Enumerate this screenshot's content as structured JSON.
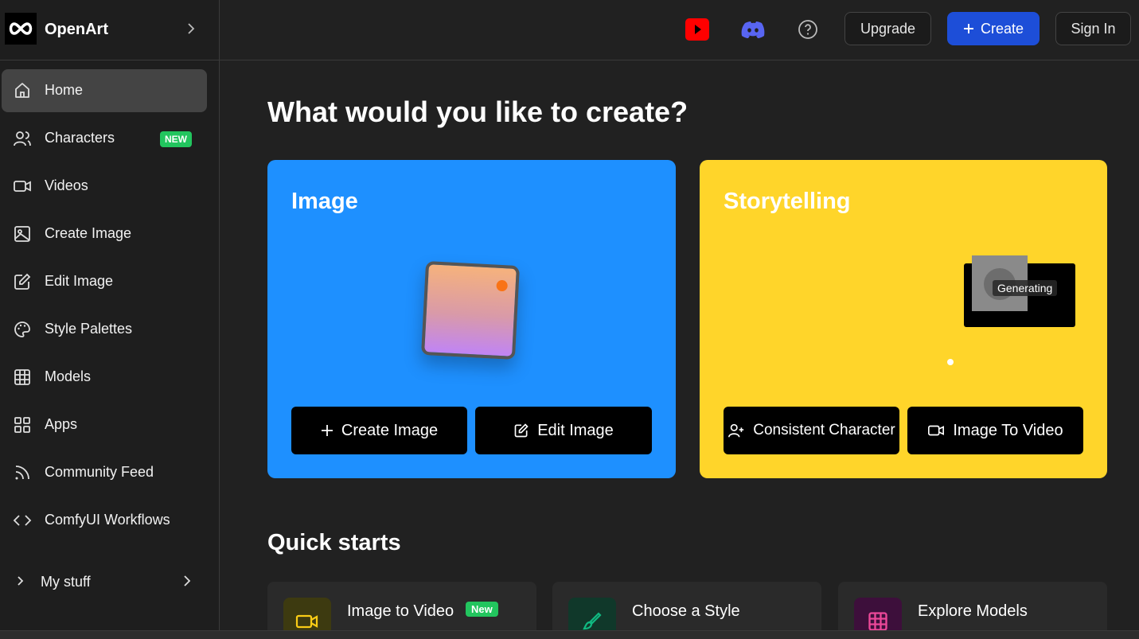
{
  "brand": {
    "name": "OpenArt"
  },
  "sidebar": {
    "items": [
      {
        "label": "Home",
        "icon": "home-icon",
        "active": true
      },
      {
        "label": "Characters",
        "icon": "users-icon",
        "badge": "NEW"
      },
      {
        "label": "Videos",
        "icon": "video-icon"
      },
      {
        "label": "Create Image",
        "icon": "image-icon"
      },
      {
        "label": "Edit Image",
        "icon": "edit-icon"
      },
      {
        "label": "Style Palettes",
        "icon": "palette-icon"
      },
      {
        "label": "Models",
        "icon": "grid-icon"
      },
      {
        "label": "Apps",
        "icon": "apps-icon"
      },
      {
        "label": "Community Feed",
        "icon": "rss-icon"
      },
      {
        "label": "ComfyUI Workflows",
        "icon": "code-icon"
      }
    ],
    "mystuff": {
      "label": "My stuff"
    }
  },
  "header": {
    "upgrade": "Upgrade",
    "create": "Create",
    "sign_in": "Sign In"
  },
  "main": {
    "title": "What would you like to create?",
    "image_card": {
      "title": "Image",
      "btn_create": "Create Image",
      "btn_edit": "Edit Image"
    },
    "story_card": {
      "title": "Storytelling",
      "generating": "Generating",
      "btn_character": "Consistent Character",
      "btn_video": "Image To Video"
    },
    "quick_starts": {
      "title": "Quick starts",
      "items": [
        {
          "label": "Image to Video",
          "badge": "New"
        },
        {
          "label": "Choose a Style"
        },
        {
          "label": "Explore Models"
        }
      ]
    }
  },
  "colors": {
    "image_card": "#1e90ff",
    "story_card": "#ffd52a",
    "primary": "#1d4ed8",
    "badge_green": "#22c55e"
  }
}
